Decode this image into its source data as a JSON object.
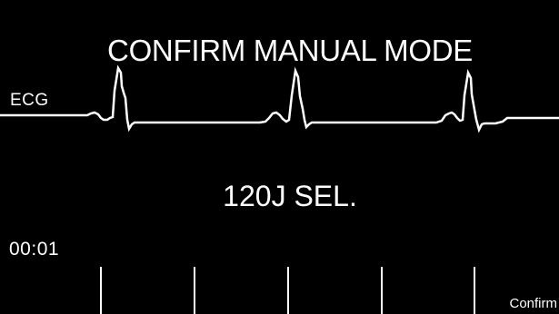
{
  "monitor": {
    "title": "CONFIRM MANUAL MODE",
    "ecg_label": "ECG",
    "energy_selection": "120J SEL.",
    "elapsed_time": "00:01"
  },
  "softkeys": {
    "labels": [
      "",
      "",
      "",
      "",
      "",
      "Confirm"
    ]
  },
  "colors": {
    "background": "#000000",
    "foreground": "#ffffff"
  }
}
